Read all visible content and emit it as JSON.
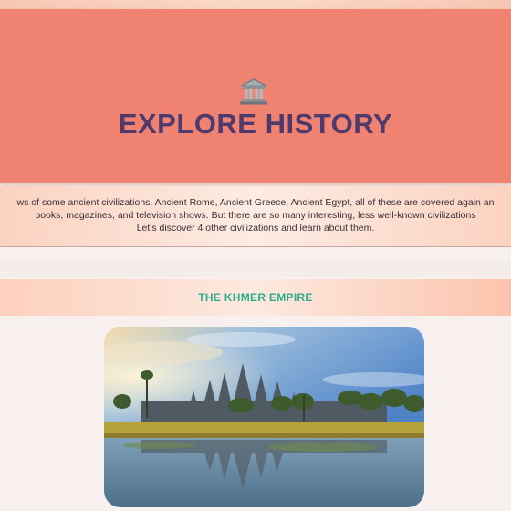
{
  "hero": {
    "icon": "museum-icon",
    "title": "EXPLORE HISTORY"
  },
  "intro": {
    "lines": [
      "ws of some ancient civilizations. Ancient Rome, Ancient Greece, Ancient Egypt, all of these are covered again an",
      "books, magazines, and television shows. But there are so many interesting, less well-known civilizations",
      "Let's discover 4 other civilizations and learn about them."
    ]
  },
  "section": {
    "title": "THE KHMER EMPIRE",
    "image": "angkor-wat-photo"
  },
  "colors": {
    "hero_bg": "#ef8271",
    "title": "#4f3a6d",
    "section_title": "#2bae8e"
  }
}
